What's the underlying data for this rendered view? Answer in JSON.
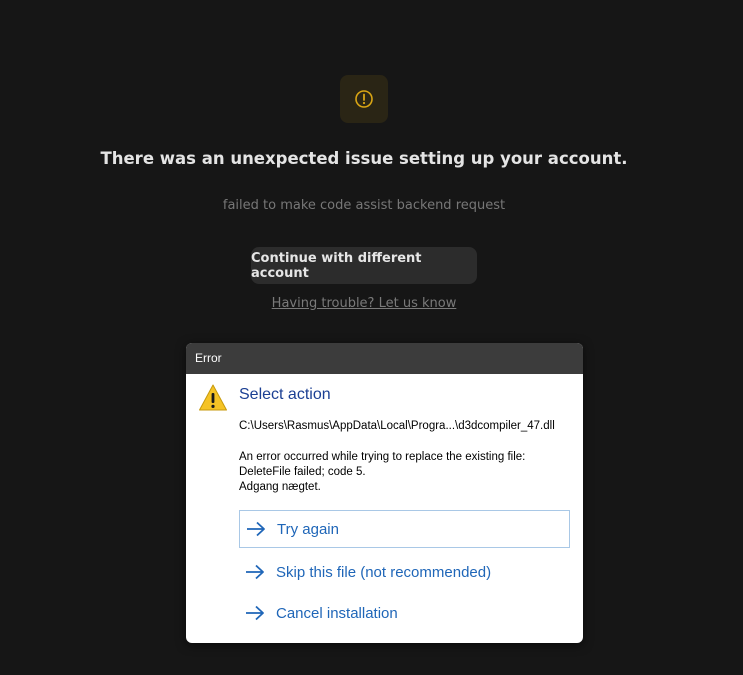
{
  "colors": {
    "background": "#161616",
    "warn_tile_bg": "#2a2515",
    "warn_icon": "#d9a514",
    "dialog_titlebar": "#3c3c3c",
    "dialog_heading": "#1b3f93",
    "command_link": "#1f66b8",
    "warning_triangle": "#f5c325"
  },
  "page": {
    "icon": "alert-circle-icon",
    "headline": "There was an unexpected issue setting up your account.",
    "subtext": "failed to make code assist backend request",
    "continue_button": "Continue with different account",
    "trouble_link": "Having trouble? Let us know"
  },
  "dialog": {
    "title": "Error",
    "icon": "warning-triangle-icon",
    "heading": "Select action",
    "path": "C:\\Users\\Rasmus\\AppData\\Local\\Progra...\\d3dcompiler_47.dll",
    "message_lines": [
      "An error occurred while trying to replace the existing file:",
      "DeleteFile failed; code 5.",
      "Adgang nægtet."
    ],
    "actions": [
      {
        "label": "Try again",
        "icon": "arrow-right-icon"
      },
      {
        "label": "Skip this file (not recommended)",
        "icon": "arrow-right-icon"
      },
      {
        "label": "Cancel installation",
        "icon": "arrow-right-icon"
      }
    ]
  }
}
